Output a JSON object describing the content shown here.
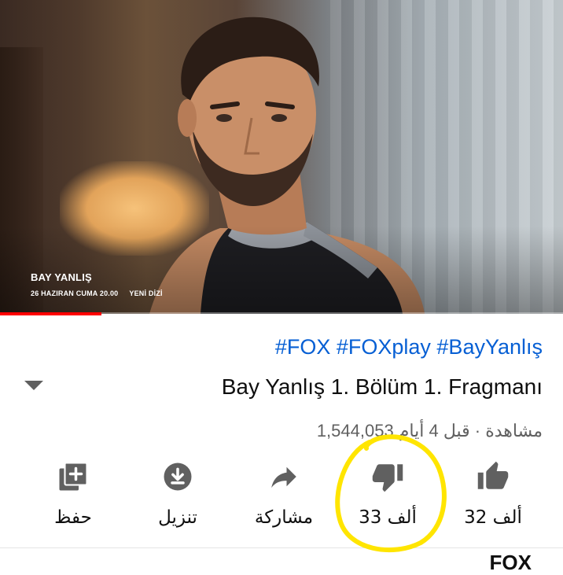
{
  "player": {
    "overlay_title": "BAY YANLIŞ",
    "overlay_date": "26 HAZIRAN  CUMA 20.00",
    "overlay_tag": "YENİ DİZİ",
    "progress_percent": 18,
    "progress_color": "#ff0000"
  },
  "video": {
    "hashtags": "#FOX #FOXplay #BayYanlış",
    "title": "Bay Yanlış 1. Bölüm 1. Fragmanı",
    "meta": "1,544,053 مشاهدة · قبل 4 أيام"
  },
  "actions": {
    "like": {
      "label": "32 ألف",
      "icon": "thumbs-up-icon"
    },
    "dislike": {
      "label": "33 ألف",
      "icon": "thumbs-down-icon"
    },
    "share": {
      "label": "مشاركة",
      "icon": "share-arrow-icon"
    },
    "download": {
      "label": "تنزيل",
      "icon": "download-icon"
    },
    "save": {
      "label": "حفظ",
      "icon": "add-to-playlist-icon"
    }
  },
  "channel_peek": "FOX",
  "colors": {
    "link": "#065fd4",
    "highlight": "#ffe500",
    "icon_gray": "#606060"
  }
}
